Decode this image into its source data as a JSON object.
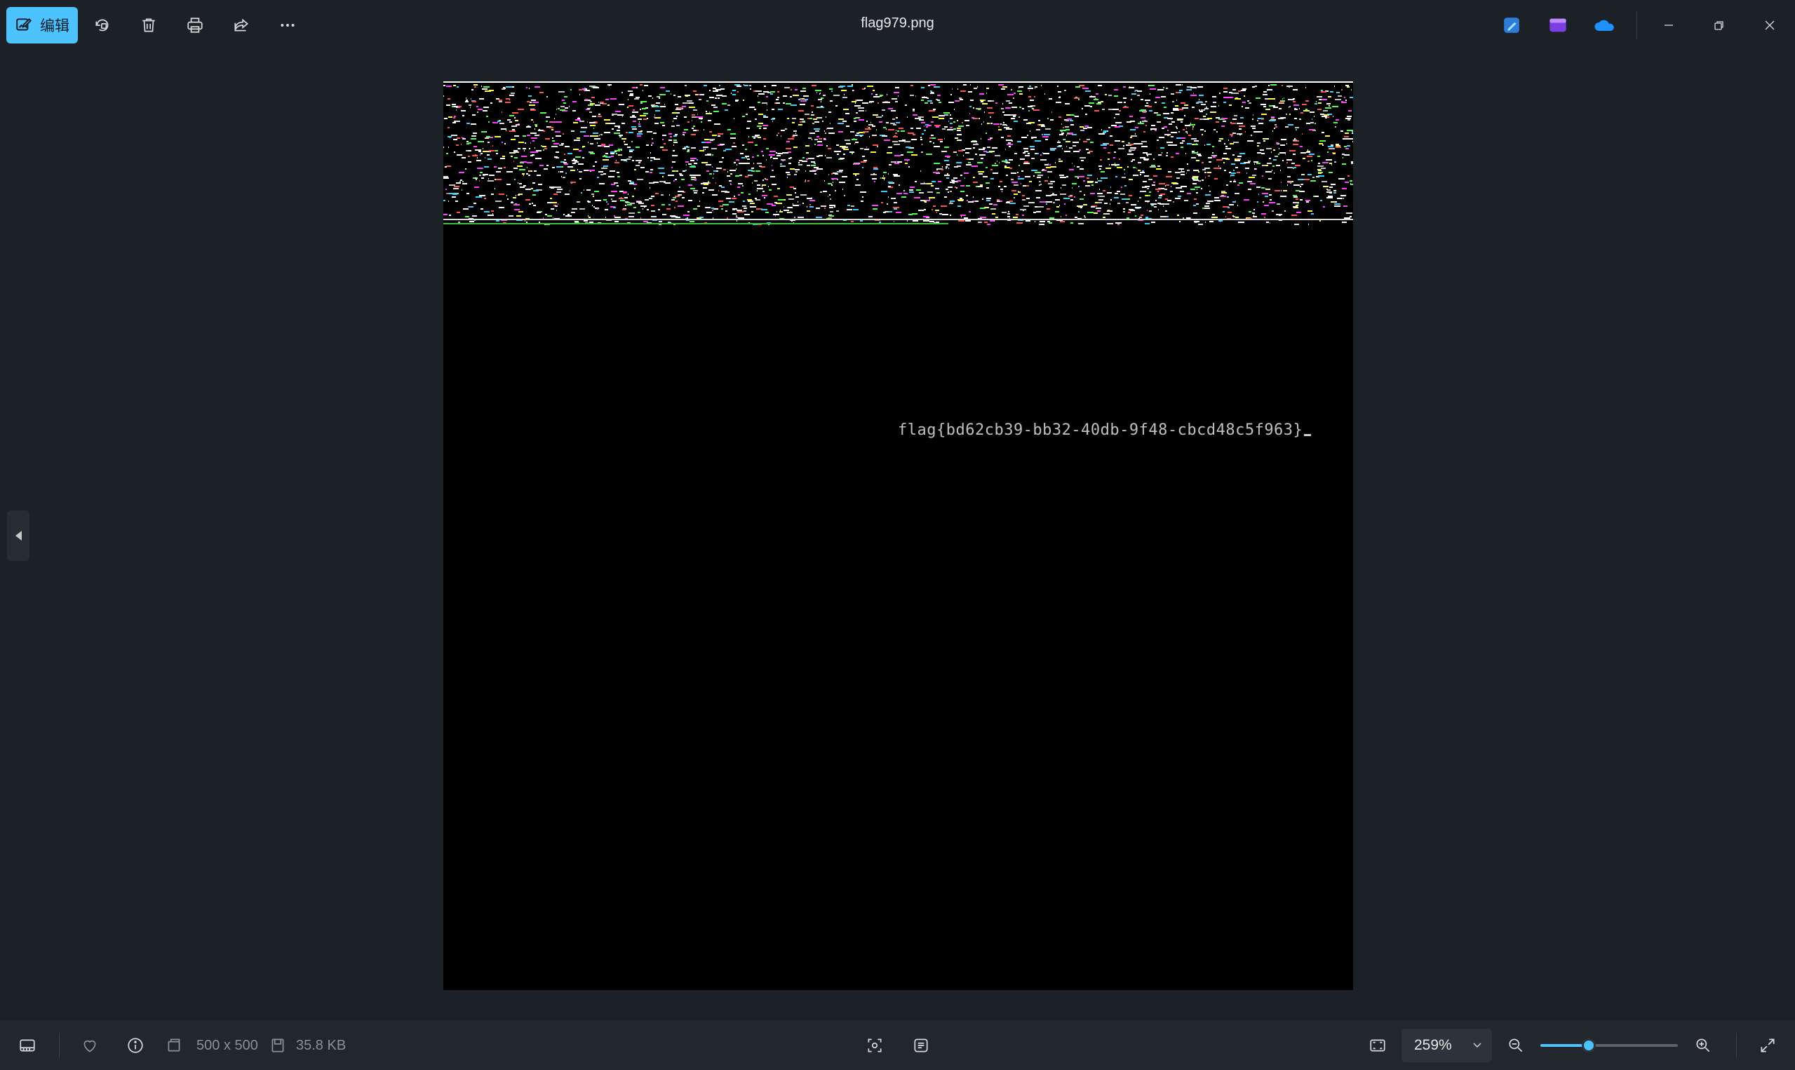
{
  "toolbar": {
    "edit_label": "编辑",
    "tools": [
      "rotate-icon",
      "delete-icon",
      "print-icon",
      "share-icon",
      "more-icon"
    ]
  },
  "window": {
    "title": "flag979.png",
    "app_icons": [
      "designer-icon",
      "clipchamp-icon",
      "onedrive-icon"
    ],
    "controls": [
      "minimize-icon",
      "restore-icon",
      "close-icon"
    ]
  },
  "image": {
    "flag_text": "flag{bd62cb39-bb32-40db-9f48-cbcd48c5f963}"
  },
  "bottom": {
    "dimensions": "500 x 500",
    "file_size": "35.8 KB",
    "zoom": "259%",
    "zoom_level": 0.35
  },
  "colors": {
    "accent": "#4cc2ff",
    "background": "#1c2128"
  }
}
